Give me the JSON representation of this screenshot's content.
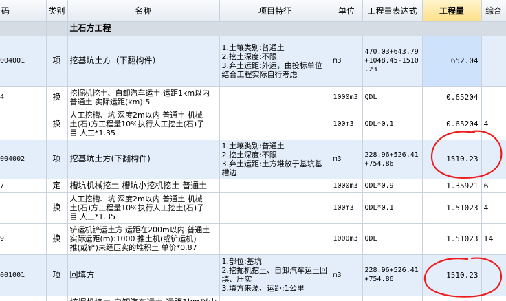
{
  "header": {
    "code": "码",
    "type": "类别",
    "name": "名称",
    "features": "项目特征",
    "unit": "单位",
    "expr": "工程量表达式",
    "qty": "工程量",
    "comp": "综合"
  },
  "section": {
    "title": "土石方工程"
  },
  "rows": [
    {
      "code": "004001",
      "type": "项",
      "name": "挖基坑土方（下翻构件）",
      "features": [
        "1.土壤类别:普通土",
        "2.挖土深度:不限",
        "3.弃土运距:外运，由投标单位结合工程实际自行考虑"
      ],
      "unit": "m3",
      "expr": [
        "470.03+643.79",
        "+1048.45-1510",
        ".23"
      ],
      "qty": "652.04",
      "comp": ""
    },
    {
      "code": "4",
      "type": "换",
      "name": [
        "挖掘机挖土、自卸汽车运土 运距1km以内",
        "普通土  实际运距(km):5"
      ],
      "features": [],
      "unit": "1000m3",
      "expr": [
        "QDL"
      ],
      "qty": "0.65204",
      "comp": ""
    },
    {
      "code": "",
      "type": "换",
      "name": [
        "人工挖槽、坑 深度2m以内 普通土  机械",
        "土(石)方工程量10%执行人工挖土(石)子",
        "目 人工*1.35"
      ],
      "features": [],
      "unit": "100m3",
      "expr": [
        "QDL*0.1"
      ],
      "qty": "0.65204",
      "comp": "4"
    },
    {
      "code": "004002",
      "type": "项",
      "name": "挖基坑土方(下翻构件)",
      "features": [
        "1.土壤类别:普通土",
        "2.挖土深度:不限",
        "3.弃土运距:土方堆放于基坑基槽边"
      ],
      "unit": "m3",
      "expr": [
        "228.96+526.41",
        "+754.86"
      ],
      "qty": "1510.23",
      "comp": ""
    },
    {
      "code": "7",
      "type": "定",
      "name": "槽坑机械挖土 槽坑小挖机挖土 普通土",
      "features": [],
      "unit": "1000m3",
      "expr": [
        "QDL*0.9"
      ],
      "qty": "1.35921",
      "comp": "6"
    },
    {
      "code": "",
      "type": "换",
      "name": [
        "人工挖槽、坑 深度2m以内 普通土  机械",
        "土(石)方工程量10%执行人工挖土(石)子",
        "目 人工*1.35"
      ],
      "features": [],
      "unit": "100m3",
      "expr": [
        "QDL*0.1"
      ],
      "qty": "1.51023",
      "comp": "4"
    },
    {
      "code": "9",
      "type": "换",
      "name": [
        "铲运机铲运土方 运距在200m以内 普通土",
        "  实际运距(m):1000  推土机(或铲运机)",
        "推(或铲)未经压实的堆积土 单价*0.87"
      ],
      "features": [],
      "unit": "1000m3",
      "expr": [
        "QDL"
      ],
      "qty": "1.51023",
      "comp": "14"
    },
    {
      "code": "001001",
      "type": "项",
      "name": "回填方",
      "features": [
        "1.部位:基坑",
        "2.挖掘机挖土、自卸汽车运土回填、压实",
        "3.填方来源、运距:1公里"
      ],
      "unit": "m3",
      "expr": [
        "228.96+526.41",
        "+754.86"
      ],
      "qty": "1510.23",
      "comp": ""
    },
    {
      "code": "",
      "type": "",
      "name": "挖掘机挖土 自卸汽车运土 运距1km以内",
      "features": [],
      "unit": "",
      "expr": [],
      "qty": "",
      "comp": ""
    }
  ]
}
